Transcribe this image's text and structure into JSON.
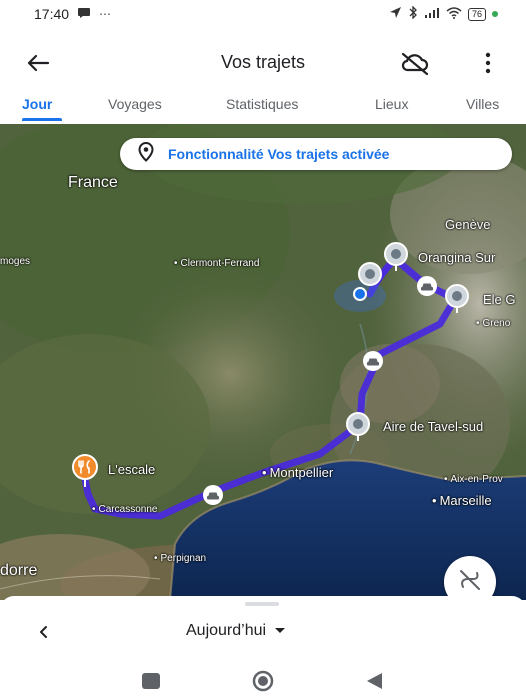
{
  "status_bar": {
    "time": "17:40",
    "notification_icons": "⋯",
    "battery": "76"
  },
  "app_bar": {
    "title": "Vos trajets"
  },
  "tabs": [
    {
      "label": "Jour",
      "active": true
    },
    {
      "label": "Voyages",
      "active": false
    },
    {
      "label": "Statistiques",
      "active": false
    },
    {
      "label": "Lieux",
      "active": false
    },
    {
      "label": "Villes",
      "active": false
    }
  ],
  "map": {
    "banner_text": "Fonctionnalité Vos trajets activée",
    "region_labels": {
      "country": "France",
      "west_edge": "moges",
      "south_west_edge": "dorre"
    },
    "city_labels": {
      "clermont": "Clermont-Ferrand",
      "geneve": "Genève",
      "grenoble": "Greno",
      "montpellier": "Montpellier",
      "carcassonne": "Carcassonne",
      "perpignan": "Perpignan",
      "aix": "Aix-en-Prov",
      "marseille": "Marseille"
    },
    "place_labels": {
      "orangina": "Orangina Sur",
      "ele": "Ele G",
      "tavel": "Aire de Tavel-sud",
      "escale": "L'escale"
    },
    "route_color": "#4a2bdb",
    "accent_color": "#1a73e8"
  },
  "sheet": {
    "date_label": "Aujourd’hui"
  }
}
